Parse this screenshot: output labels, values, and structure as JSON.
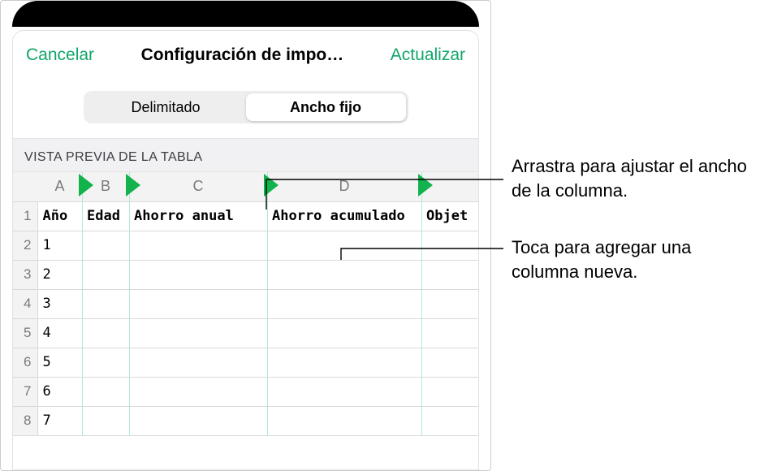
{
  "navbar": {
    "cancel_label": "Cancelar",
    "title": "Configuración de impo…",
    "update_label": "Actualizar"
  },
  "segmented": {
    "delimited_label": "Delimitado",
    "fixed_label": "Ancho fijo",
    "selected": "fixed"
  },
  "section_label": "VISTA PREVIA DE LA TABLA",
  "columns": [
    "A",
    "B",
    "C",
    "D"
  ],
  "header_row": [
    "Año",
    "Edad",
    "Ahorro anual",
    "Ahorro acumulado",
    "Objet"
  ],
  "rows": [
    {
      "n": "1"
    },
    {
      "n": "2",
      "v": "1"
    },
    {
      "n": "3",
      "v": "2"
    },
    {
      "n": "4",
      "v": "3"
    },
    {
      "n": "5",
      "v": "4"
    },
    {
      "n": "6",
      "v": "5"
    },
    {
      "n": "7",
      "v": "6"
    },
    {
      "n": "8",
      "v": "7"
    }
  ],
  "callouts": {
    "drag": "Arrastra para ajustar el ancho de la columna.",
    "tap": "Toca para agregar una columna nueva."
  }
}
